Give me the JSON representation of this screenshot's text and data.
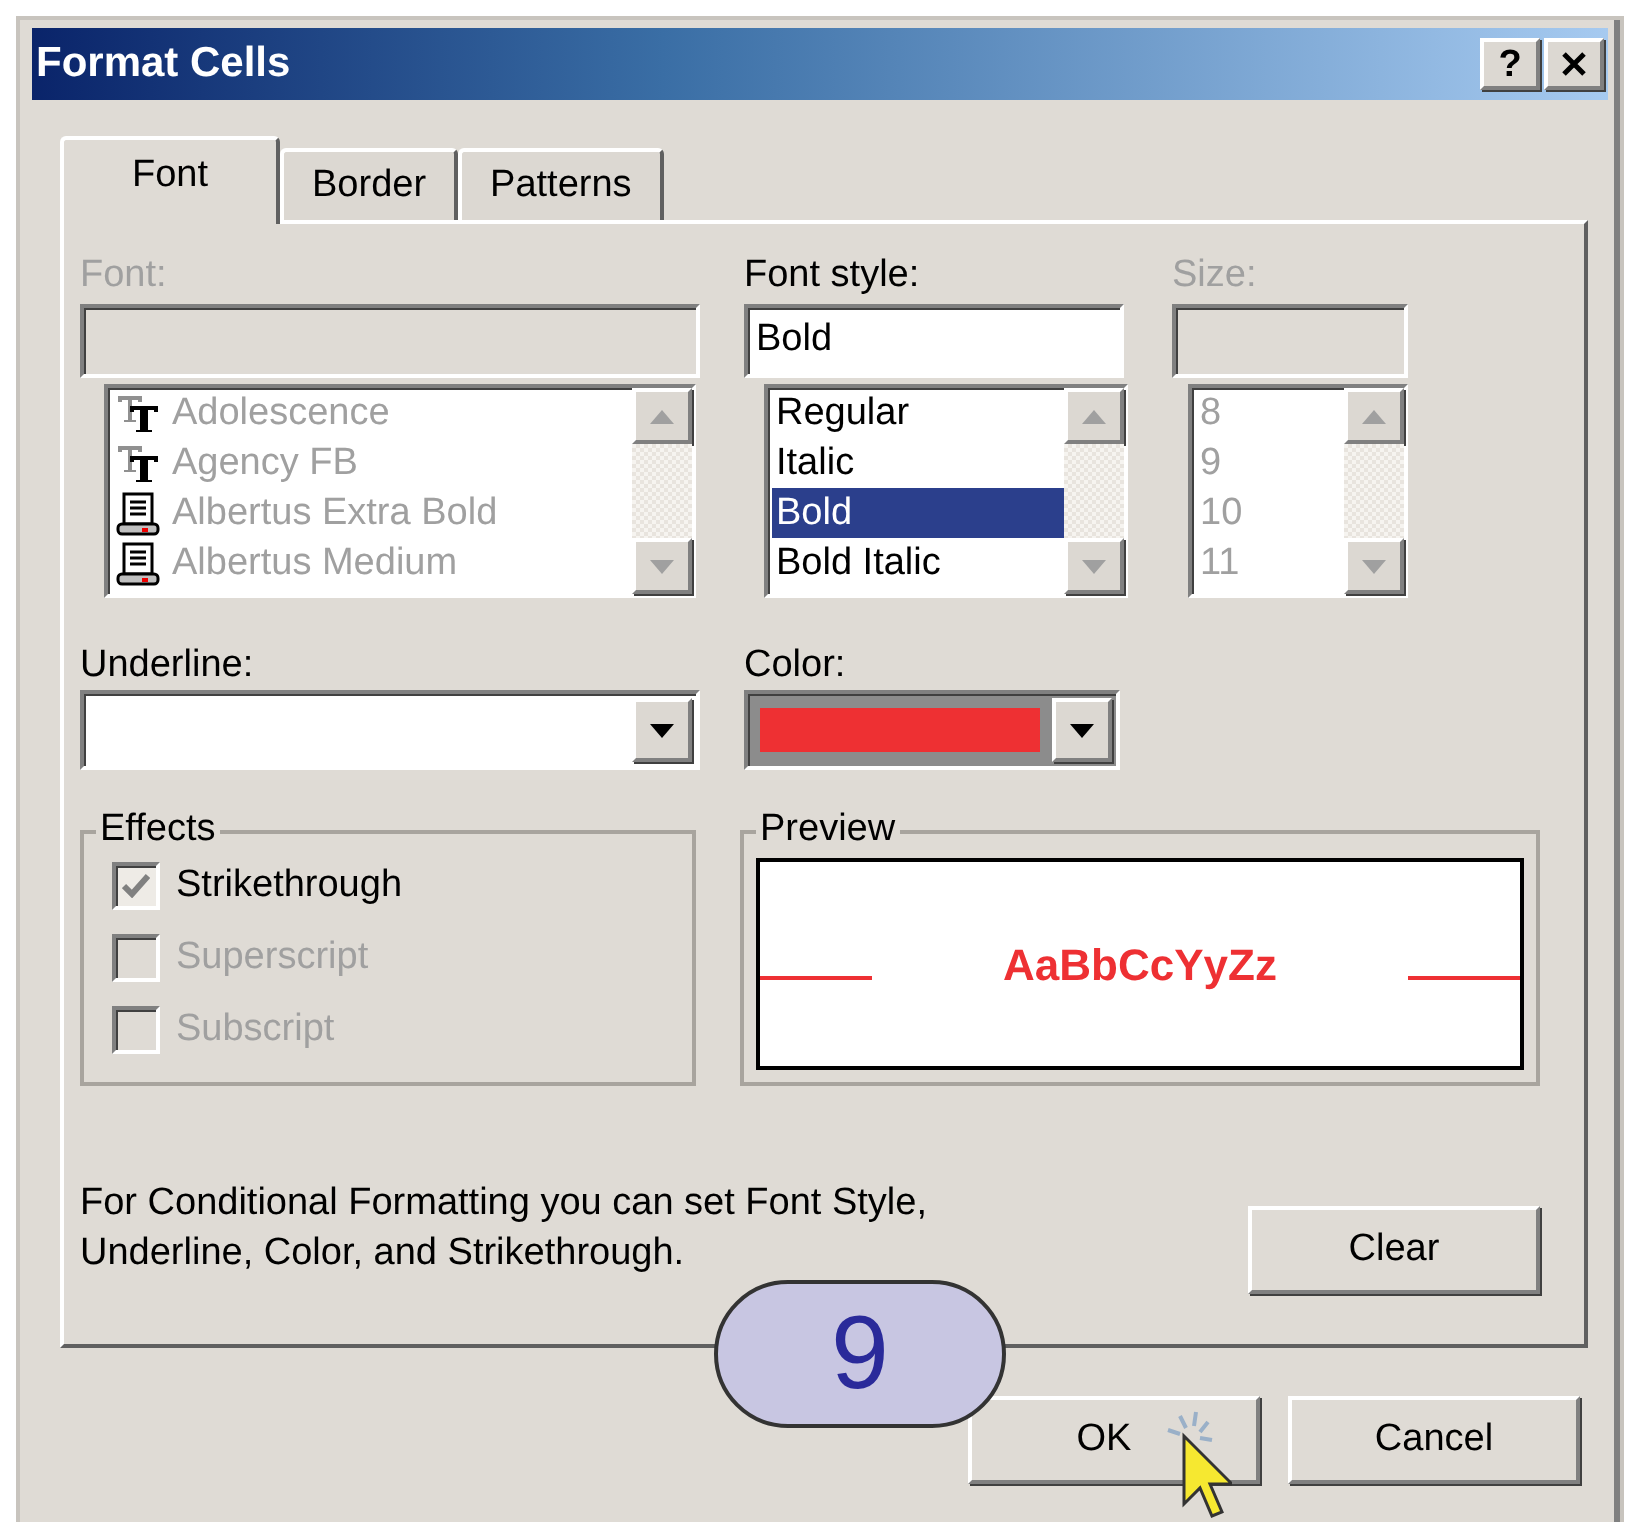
{
  "window": {
    "title": "Format Cells",
    "help": "?"
  },
  "tabs": [
    {
      "label": "Font",
      "selected": true
    },
    {
      "label": "Border",
      "selected": false
    },
    {
      "label": "Patterns",
      "selected": false
    }
  ],
  "font": {
    "label": "Font:",
    "disabled": true,
    "items": [
      {
        "name": "Adolescence",
        "kind": "truetype"
      },
      {
        "name": "Agency FB",
        "kind": "truetype"
      },
      {
        "name": "Albertus Extra Bold",
        "kind": "printer"
      },
      {
        "name": "Albertus Medium",
        "kind": "printer"
      }
    ]
  },
  "font_style": {
    "label": "Font style:",
    "value": "Bold",
    "items": [
      {
        "name": "Regular",
        "selected": false
      },
      {
        "name": "Italic",
        "selected": false
      },
      {
        "name": "Bold",
        "selected": true
      },
      {
        "name": "Bold Italic",
        "selected": false
      }
    ]
  },
  "size": {
    "label": "Size:",
    "disabled": true,
    "items": [
      "8",
      "9",
      "10",
      "11"
    ]
  },
  "underline": {
    "label": "Underline:"
  },
  "color": {
    "label": "Color:",
    "color": "#ee3033"
  },
  "effects": {
    "title": "Effects",
    "options": [
      {
        "label": "Strikethrough",
        "checked": true,
        "disabled": false
      },
      {
        "label": "Superscript",
        "checked": false,
        "disabled": true
      },
      {
        "label": "Subscript",
        "checked": false,
        "disabled": true
      }
    ]
  },
  "preview": {
    "title": "Preview",
    "sample": "AaBbCcYyZz"
  },
  "note": "For Conditional Formatting you can set Font Style, Underline, Color, and Strikethrough.",
  "buttons": {
    "clear": "Clear",
    "ok": "OK",
    "cancel": "Cancel"
  },
  "callout": "9"
}
